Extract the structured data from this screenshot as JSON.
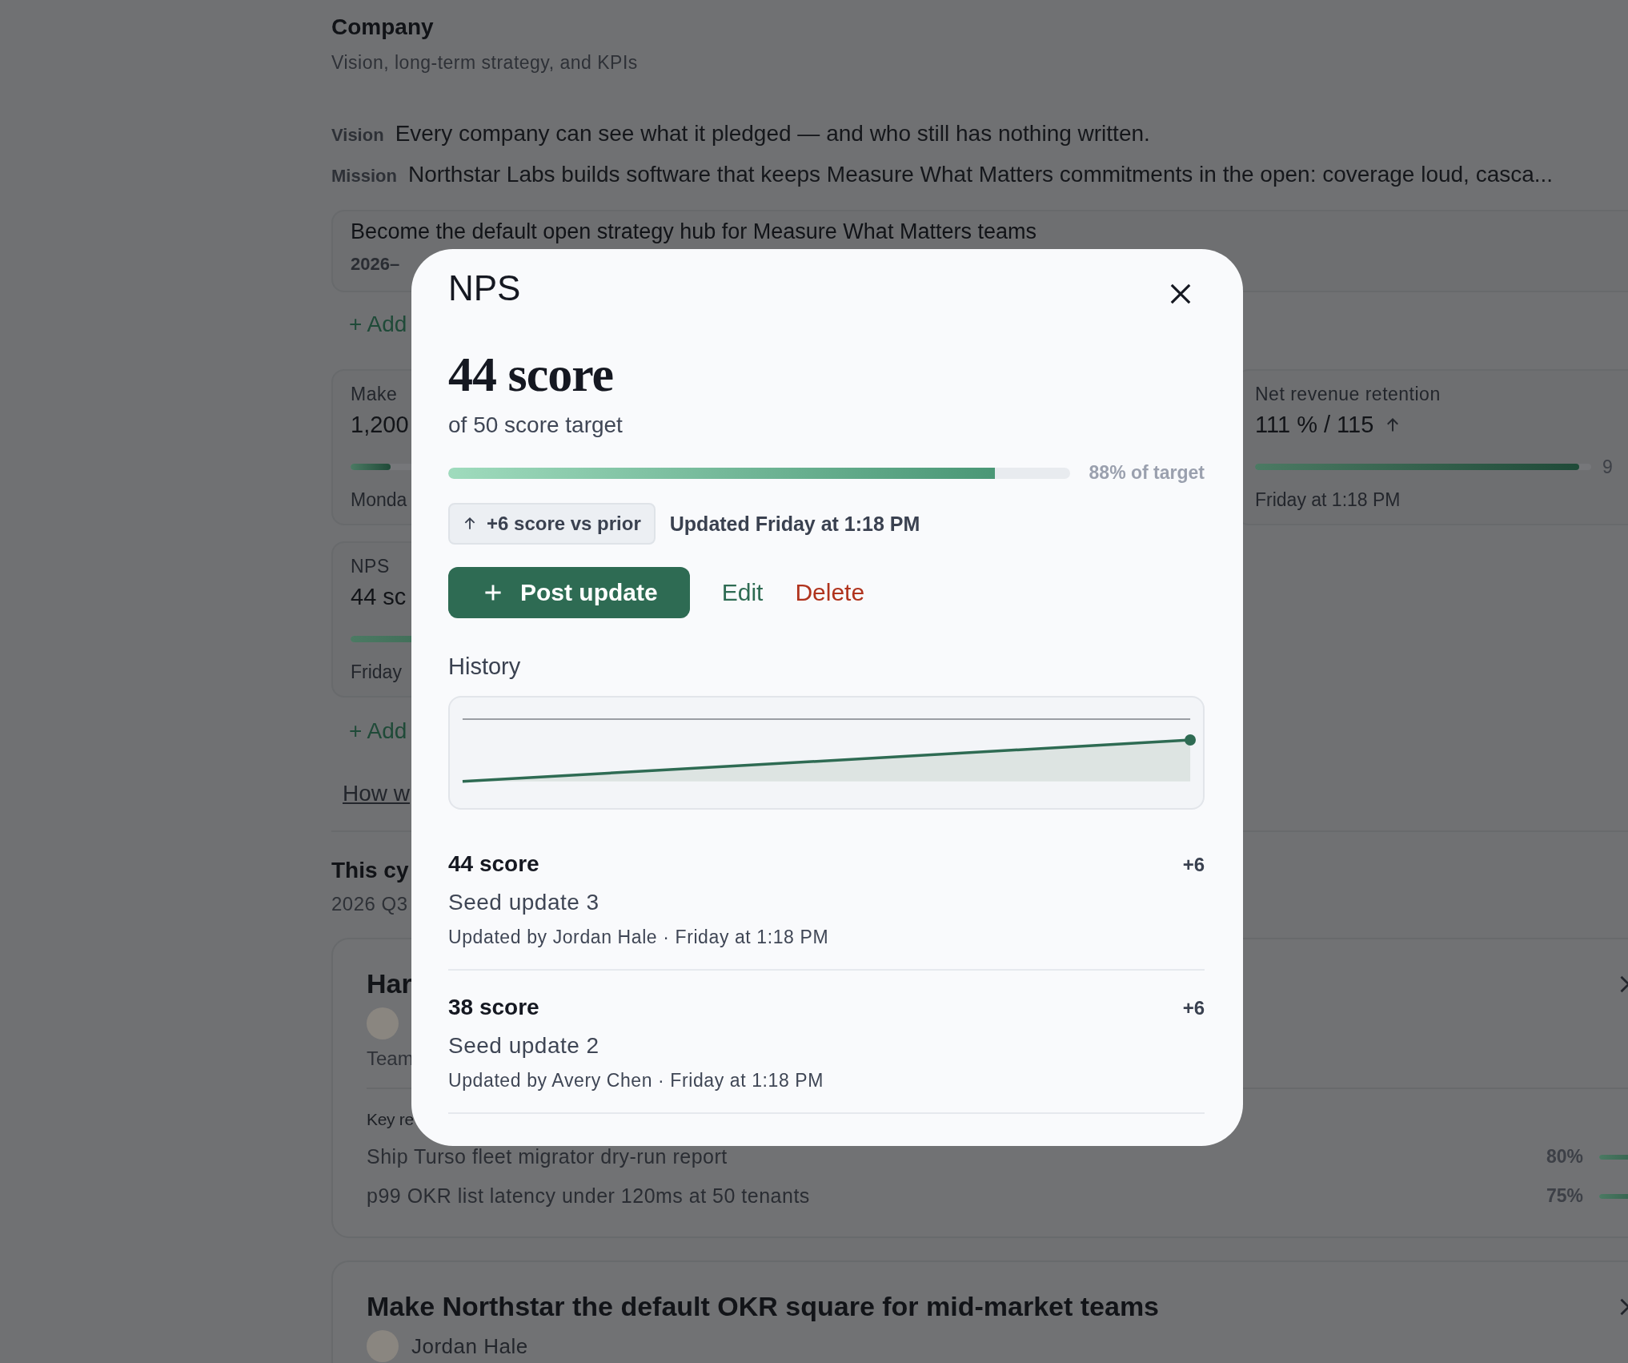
{
  "page": {
    "section_title": "Company",
    "section_subtitle": "Vision, long-term strategy, and KPIs",
    "statements": [
      {
        "label": "Vision",
        "text": "Every company can see what it pledged — and who still has nothing written."
      },
      {
        "label": "Mission",
        "text": "Northstar Labs builds software that keeps Measure What Matters commitments in the open: coverage loud, casca..."
      }
    ],
    "objective": {
      "title": "Become the default open strategy hub for Measure What Matters teams",
      "period": "2026–"
    },
    "add_link_top": "+ Add",
    "kr_cards": [
      {
        "title": "Make",
        "value": "1,200",
        "level": 0.12,
        "time": "Monda"
      },
      {
        "title": "Net revenue retention",
        "value": "111 % / 115",
        "level": 0.965,
        "percent": "9",
        "time": "Friday at 1:18 PM"
      },
      {
        "title": "NPS",
        "value": "44 sc",
        "level": 0.88,
        "time": "Friday"
      }
    ],
    "add_link_bottom": "+ Add",
    "help_link": "How w",
    "cycle_title": "This cy",
    "cycle_period": "2026 Q3",
    "cycle_objectives": [
      {
        "title": "Har",
        "team": "Team",
        "kr_heading": "Key re",
        "key_results": [
          {
            "title": "Ship Turso fleet migrator dry-run report",
            "percent": "80%",
            "level": 0.8
          },
          {
            "title": "p99 OKR list latency under 120ms at 50 tenants",
            "percent": "75%",
            "level": 0.75
          }
        ]
      },
      {
        "title": "Make Northstar the default OKR square for mid-market teams",
        "owner": "Jordan Hale"
      }
    ]
  },
  "modal": {
    "title": "NPS",
    "value": "44 score",
    "target": "of 50 score target",
    "level": 0.88,
    "progress_label": "88% of target",
    "delta_chip": "+6 score vs prior",
    "updated": "Updated Friday at 1:18 PM",
    "actions": [
      {
        "kind": "primary",
        "label": "Post update"
      },
      {
        "kind": "link",
        "label": "Edit"
      },
      {
        "kind": "danger",
        "label": "Delete"
      }
    ],
    "history_title": "History",
    "updates": [
      {
        "value": "44 score",
        "delta": "+6",
        "note": "Seed update 3",
        "meta": "Updated by Jordan Hale · Friday at 1:18 PM"
      },
      {
        "value": "38 score",
        "delta": "+6",
        "note": "Seed update 2",
        "meta": "Updated by Avery Chen · Friday at 1:18 PM"
      }
    ]
  }
}
